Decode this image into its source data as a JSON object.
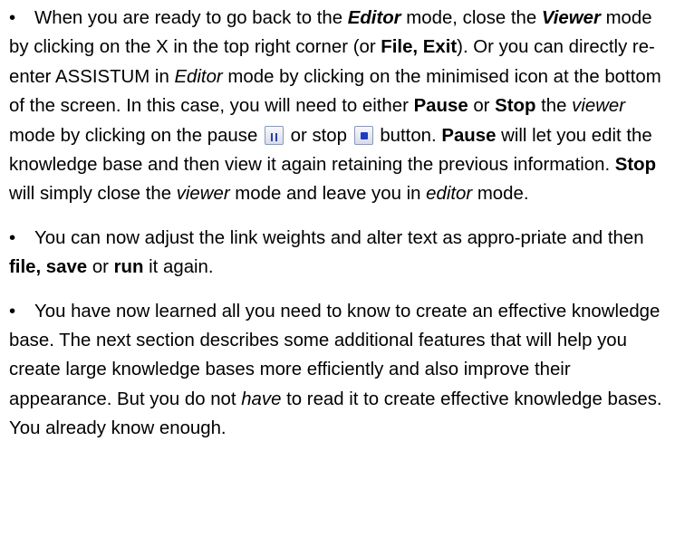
{
  "bullet_glyph": "•",
  "p1": {
    "t1": "When you are ready to go back to the ",
    "t2": "Editor",
    "t3": " mode, close the ",
    "t4": "Viewer",
    "t5": " mode by clicking on the X in the top right corner (or ",
    "t6": "File, Exit",
    "t7": ").  Or you can directly re-enter ASSISTUM in ",
    "t8": "Editor",
    "t9": " mode by clicking on the minimised icon at the bottom of the screen.  In this case, you will need to either ",
    "t10": "Pause",
    "t11": " or ",
    "t12": "Stop",
    "t13": " the ",
    "t14": "viewer",
    "t15": " mode by clicking on the pause ",
    "t16": " or stop ",
    "t17": " button. ",
    "t18": "Pause",
    "t19": " will let you edit the knowledge base and then view it again retaining the previous information.  ",
    "t20": "Stop",
    "t21": " will simply close the ",
    "t22": "viewer",
    "t23": " mode and leave you in ",
    "t24": "editor",
    "t25": " mode."
  },
  "p2": {
    "t1": "You can now adjust the link weights and alter text as appro-priate and then ",
    "t2": "file, save",
    "t3": " or ",
    "t4": "run",
    "t5": " it again."
  },
  "p3": {
    "t1": "You have now learned all you need to know to create an effective knowledge base.  The next section describes some additional features that will help you create large knowledge bases more efficiently and also improve their appearance.  But you do not ",
    "t2": "have",
    "t3": " to read it to create effective knowledge bases. You already know enough."
  },
  "icons": {
    "pause": "pause-icon",
    "stop": "stop-icon"
  }
}
